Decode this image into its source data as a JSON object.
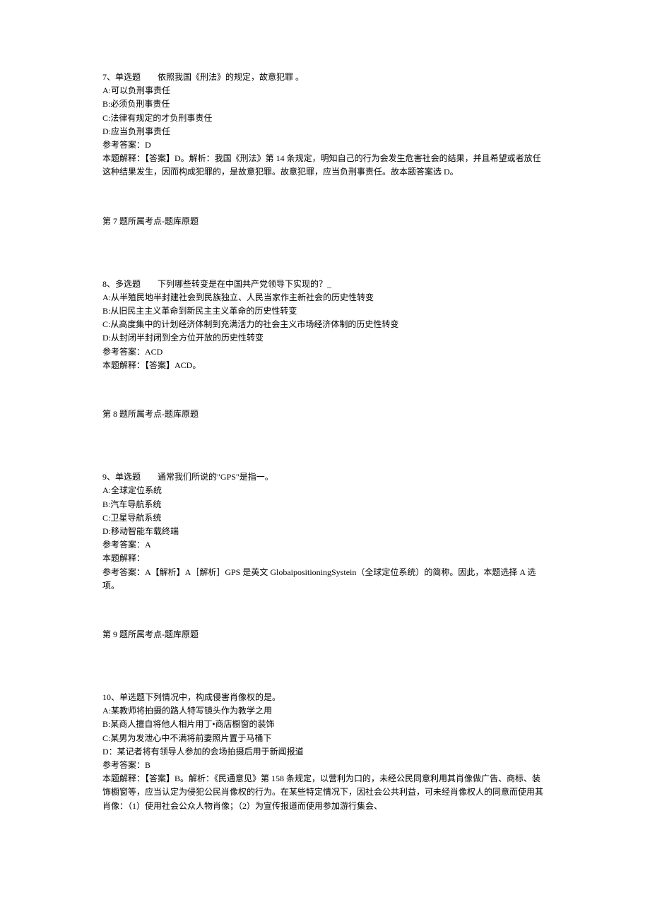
{
  "questions": [
    {
      "header": "7、单选题　　依照我国《刑法》的规定，故意犯罪 。",
      "options": [
        "A:可以负刑事责任",
        "B:必须负刑事责任",
        "C:法律有规定的才负刑事责任",
        "D:应当负刑事责任"
      ],
      "answer_label": "参考答案：D",
      "explanation": "本题解释：【答案】D。解析：我国《刑法》第 14 条规定，明知自己的行为会发生危害社会的结果，并且希望或者放任这种结果发生，因而构成犯罪的，是故意犯罪。故意犯罪，应当负刑事责任。故本题答案选 D。",
      "topic_ref": "第 7 题所属考点-题库原题"
    },
    {
      "header": "8、多选题　　下列哪些转变是在中国共产党领导下实现的？_",
      "options": [
        "A:从半殖民地半封建社会到民族独立、人民当家作主新社会的历史性转变",
        "B:从旧民主主义革命到新民主主义革命的历史性转变",
        "C:从高度集中的计划经济体制到充满活力的社会主义市场经济体制的历史性转变",
        "D:从封闭半封闭到全方位开放的历史性转变"
      ],
      "answer_label": "参考答案：ACD",
      "explanation": "本题解释：【答案】ACD。",
      "topic_ref": "第 8 题所属考点-题库原题"
    },
    {
      "header": "9、单选题　　通常我们所说的\"GPS\"是指一。",
      "options": [
        "A:全球定位系统",
        "B:汽车导航系统",
        "C:卫星导航系统",
        "D:移动智能车载终端"
      ],
      "answer_label": "参考答案：A",
      "explanation_pre": "本题解释：",
      "explanation": "参考答案：A【解析】A［解析］GPS 是英文 GlobaipositioningSystein（全球定位系统）的简称。因此，本题选择 A 选项。",
      "topic_ref": "第 9 题所属考点-题库原题"
    },
    {
      "header": "10、单选题下列情况中，构成侵害肖像权的是。",
      "options": [
        "A:某教师将拍摄的路人特写镜头作为教学之用",
        "B:某商人擅自将他人相片用丁•商店橱窗的装饰",
        "C:某男为发泄心中不满将前妻照片置于马桶下",
        "D：某记者将有领导人参加的会场拍摄后用于新闻报道"
      ],
      "answer_label": "参考答案：B",
      "explanation": "本题解释：【答案】B。解析：《民通意见》第 158 条规定，以营利为口的，未经公民同意利用其肖像做广告、商标、装饰橱窗等，应当认定为侵犯公民肖像权的行为。在某些特定情况下，因社会公共利益，可未经肖像权人的同意而使用其肖像：（1）使用社会公众人物肖像；（2）为宣传报道而使用参加游行集会、",
      "topic_ref": ""
    }
  ]
}
